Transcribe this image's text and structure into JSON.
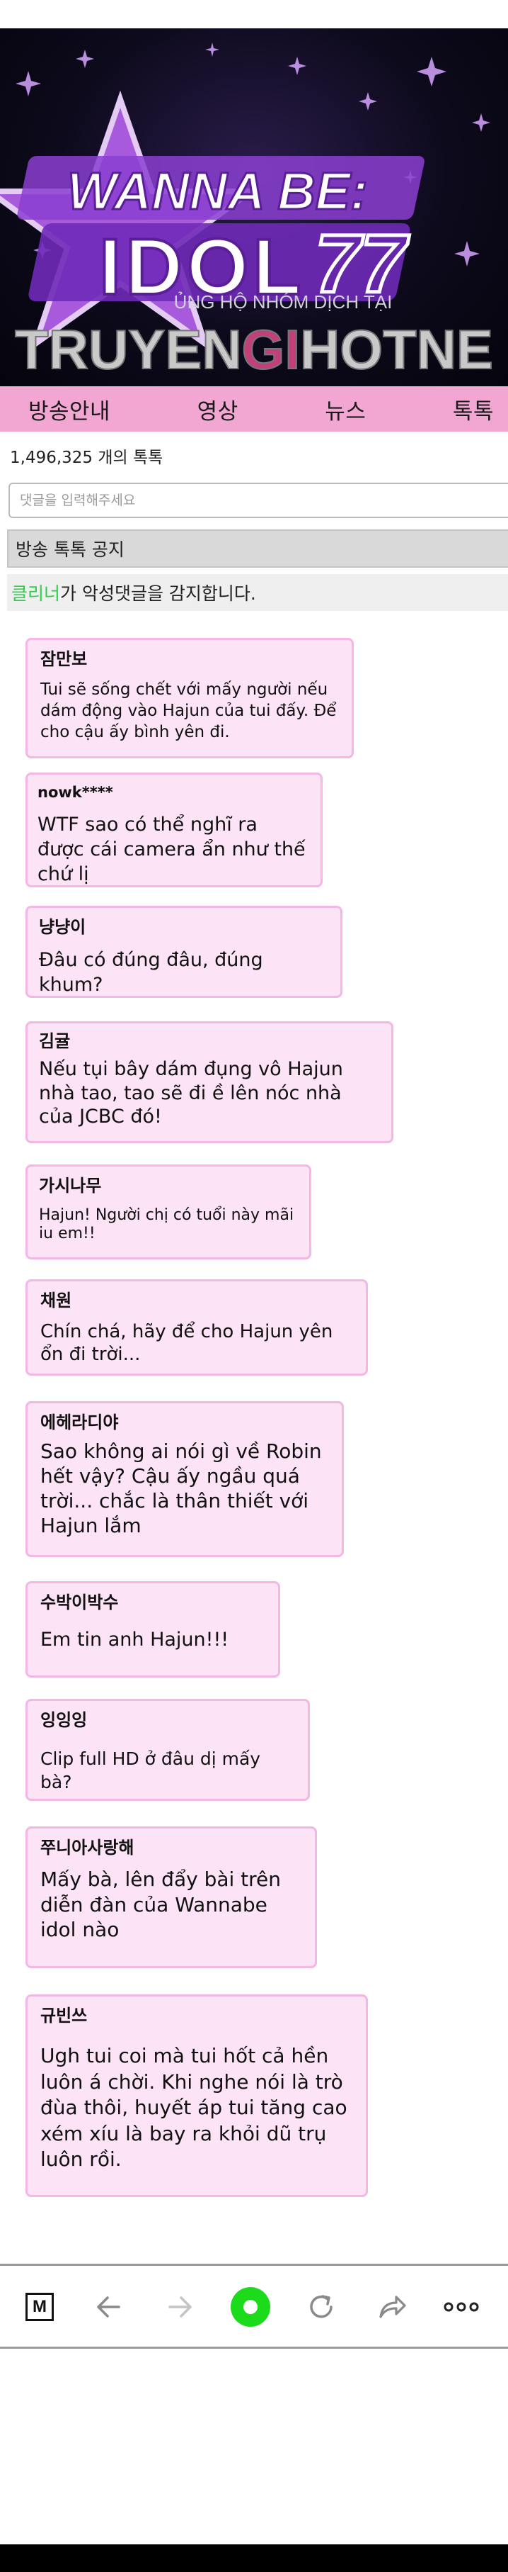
{
  "banner": {
    "logo_line1": "WANNA BE:",
    "logo_line2": "IDOL",
    "logo_number": "77",
    "support_text": "ỦNG HỘ NHÓM DỊCH TẠI",
    "watermark_part1": "TRUYEN",
    "watermark_part2": "GI",
    "watermark_part3": "HOTNE",
    "colors": {
      "purple": "#8b3fd1",
      "pink_accent": "#c2407a"
    }
  },
  "nav": {
    "items": [
      {
        "label": "방송안내"
      },
      {
        "label": "영상"
      },
      {
        "label": "뉴스"
      },
      {
        "label": "톡톡"
      }
    ],
    "color": "#f2a6d2"
  },
  "talk": {
    "count_text": "1,496,325 개의 톡톡",
    "input_placeholder": "댓글을 입력해주세요",
    "notice_text": "방송 톡톡 공지",
    "cleaner_name": "클리너",
    "cleaner_text": "가 악성댓글을 감지합니다."
  },
  "comments": [
    {
      "name": "잠만보",
      "text": "Tui sẽ sống chết với mấy người nếu dám động vào Hajun của tui đấy. Để cho cậu ấy bình yên đi."
    },
    {
      "name": "nowk****",
      "text": "WTF sao có thể nghĩ ra được cái camera ẩn như thế chứ lị"
    },
    {
      "name": "냥냥이",
      "text": "Đâu có đúng đâu, đúng khum?"
    },
    {
      "name": "김귤",
      "text": "Nếu tụi bây dám đụng vô Hajun nhà tao, tao sẽ đi ề lên nóc nhà của JCBC đó!"
    },
    {
      "name": "가시나무",
      "text": "Hajun! Người chị có tuổi này mãi iu em!!"
    },
    {
      "name": "채원",
      "text": "Chín chá, hãy để cho Hajun yên ổn đi trời..."
    },
    {
      "name": "에헤라디야",
      "text": "Sao không ai nói gì về Robin hết vậy? Cậu ấy ngầu quá trời... chắc là thân thiết với Hajun lắm"
    },
    {
      "name": "수박이박수",
      "text": "Em tin anh Hajun!!!"
    },
    {
      "name": "잉잉잉",
      "text": "Clip full HD ở đâu dị mấy bà?"
    },
    {
      "name": "쭈니아사랑해",
      "text": "Mấy bà, lên đẩy bài trên diễn đàn của Wannabe idol nào"
    },
    {
      "name": "규빈쓰",
      "text": "Ugh tui coi mà tui hốt cả hền luôn á chời. Khi nghe nói là trò đùa thôi, huyết áp tui tăng cao xém xíu là bay ra khỏi dũ trụ luôn rồi."
    }
  ],
  "bottom_bar": {
    "m_label": "M",
    "icons": [
      "m-icon",
      "back-arrow-icon",
      "forward-arrow-icon",
      "record-icon",
      "refresh-icon",
      "share-icon",
      "more-icon"
    ],
    "record_color": "#1bdb1b"
  }
}
